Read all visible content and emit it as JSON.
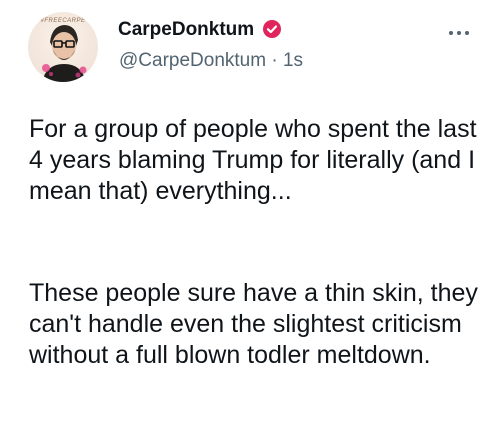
{
  "author": {
    "display_name": "CarpeDonktum",
    "handle": "@CarpeDonktum",
    "separator": "·",
    "timestamp": "1s",
    "verified_color": "#e0245e",
    "avatar_tag": "#FREECARPE"
  },
  "menu": {
    "icon": "more-horizontal-icon"
  },
  "tweet": {
    "paragraphs": [
      "For a group of people who spent the last 4 years blaming Trump for literally (and I mean that) everything...",
      "These people sure have a thin skin, they can't handle even the slightest criticism without a full blown todler meltdown."
    ]
  }
}
